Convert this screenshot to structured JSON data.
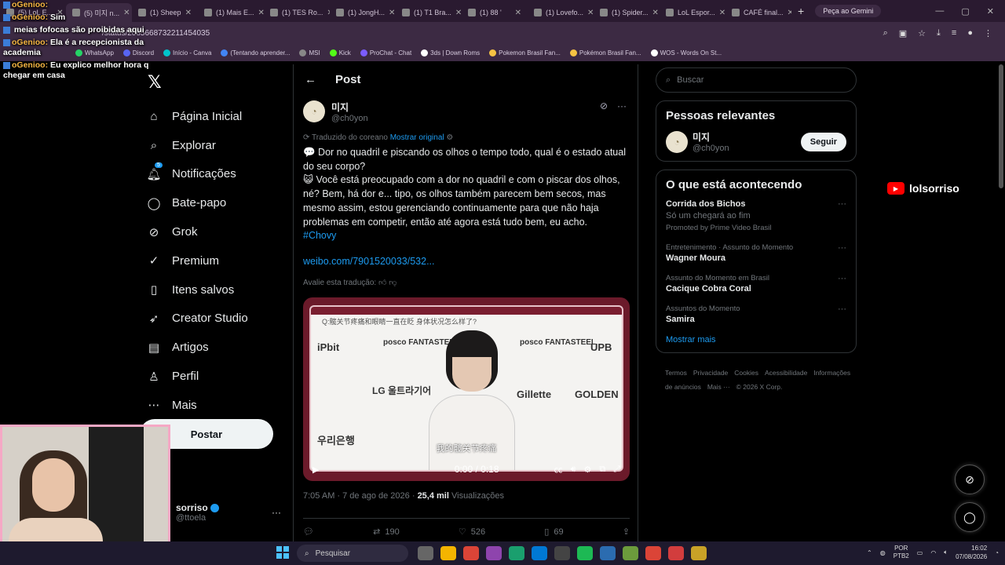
{
  "browser": {
    "tabs": [
      {
        "label": "(5) LoL E...",
        "active": false
      },
      {
        "label": "(5) 미지 n...",
        "active": true
      },
      {
        "label": "(1) Sheep",
        "active": false
      },
      {
        "label": "(1) Mais E...",
        "active": false
      },
      {
        "label": "(1) TES Ro...",
        "active": false
      },
      {
        "label": "(1) JongH...",
        "active": false
      },
      {
        "label": "(1) T1 Bra...",
        "active": false
      },
      {
        "label": "(1) 88 '",
        "active": false
      },
      {
        "label": "(1) Lovefo...",
        "active": false
      },
      {
        "label": "(1) Spider...",
        "active": false
      },
      {
        "label": "LoL Espor...",
        "active": false
      },
      {
        "label": "CAFÉ final...",
        "active": false
      }
    ],
    "new_tab": "+",
    "gemini_button": "Peça ao Gemini",
    "url": "/status/2085668732211454035",
    "bookmarks": [
      {
        "label": "Discord",
        "color": "#5865f2"
      },
      {
        "label": "Início - Canva",
        "color": "#00c4cc"
      },
      {
        "label": "(Tentando aprender...",
        "color": "#4285f4"
      },
      {
        "label": "MSI",
        "color": "#888888"
      },
      {
        "label": "Kick",
        "color": "#53fc18"
      },
      {
        "label": "ProChat - Chat",
        "color": "#7b5cff"
      },
      {
        "label": "3ds | Down Roms",
        "color": "#ffffff"
      },
      {
        "label": "Pokemon Brasil Fan...",
        "color": "#f6c343"
      },
      {
        "label": "Pokémon Brasil Fan...",
        "color": "#f6c343"
      },
      {
        "label": "WOS - Words On St...",
        "color": "#ffffff"
      }
    ],
    "whatsapp_bookmark": "WhatsApp"
  },
  "chat_overlay": [
    {
      "user": "oGenioo:",
      "text": ""
    },
    {
      "user": "oGenioo:",
      "text": "Sim"
    },
    {
      "user": "",
      "text": "meias fofocas são proibidas aqui"
    },
    {
      "user": "oGenioo:",
      "text": "Ela é a recepcionista da academia"
    },
    {
      "user": "oGenioo:",
      "text": "Eu explico melhor hora q chegar em casa"
    }
  ],
  "nav": {
    "items": [
      {
        "label": "Página Inicial",
        "icon": "home-icon"
      },
      {
        "label": "Explorar",
        "icon": "search-icon"
      },
      {
        "label": "Notificações",
        "icon": "bell-icon",
        "badge": "5"
      },
      {
        "label": "Bate-papo",
        "icon": "chat-icon"
      },
      {
        "label": "Grok",
        "icon": "grok-icon"
      },
      {
        "label": "Premium",
        "icon": "verified-icon"
      },
      {
        "label": "Itens salvos",
        "icon": "bookmark-icon"
      },
      {
        "label": "Creator Studio",
        "icon": "rocket-icon"
      },
      {
        "label": "Artigos",
        "icon": "article-icon"
      },
      {
        "label": "Perfil",
        "icon": "person-icon"
      },
      {
        "label": "Mais",
        "icon": "more-icon"
      }
    ],
    "post_button": "Postar",
    "account": {
      "name": "sorriso",
      "handle": "@ttoela"
    }
  },
  "post": {
    "header_title": "Post",
    "author_name": "미지",
    "author_handle": "@ch0yon",
    "translated_label": "Traduzido do coreano",
    "show_original": "Mostrar original",
    "body_line1": "💬 Dor no quadril e piscando os olhos o tempo todo, qual é o estado atual do seu corpo?",
    "body_line2": "😺 Você está preocupado com a dor no quadril e com o piscar dos olhos, né? Bem, há dor e... tipo, os olhos também parecem bem secos, mas mesmo assim, estou gerenciando continuamente para que não haja problemas em competir, então até agora está tudo bem, eu acho.",
    "hashtag": "#Chovy",
    "link": "weibo.com/7901520033/532...",
    "rate_translation": "Avalie esta tradução:",
    "video": {
      "time": "0:00 / 0:18",
      "caption": "我的髋关节疼痛",
      "quote": "Q:髋关节疼痛和眼睛一直在眨 身体状况怎么样了?",
      "brands": [
        "iPbit",
        "posco FANTASTEEL",
        "posco FANTASTEEL",
        "UPB",
        "LG 울트라기어",
        "Gillette",
        "GOLDEN",
        "우리은행"
      ]
    },
    "timestamp": "7:05 AM · 7 de ago de 2026",
    "views_count": "25,4 mil",
    "views_label": "Visualizações",
    "reposts": "190",
    "likes": "526",
    "bookmarks": "69"
  },
  "sidebar": {
    "search_placeholder": "Buscar",
    "relevant_title": "Pessoas relevantes",
    "relevant_name": "미지",
    "relevant_handle": "@ch0yon",
    "follow_label": "Seguir",
    "happening_title": "O que está acontecendo",
    "trends": [
      {
        "context": "",
        "title": "Corrida dos Bichos",
        "subtitle": "Só um chegará ao fim",
        "promo": "Promoted by Prime Video Brasil"
      },
      {
        "context": "Entretenimento · Assunto do Momento",
        "title": "Wagner Moura",
        "subtitle": "",
        "promo": ""
      },
      {
        "context": "Assunto do Momento em Brasil",
        "title": "Cacique Cobra Coral",
        "subtitle": "",
        "promo": ""
      },
      {
        "context": "Assuntos do Momento",
        "title": "Samira",
        "subtitle": "",
        "promo": ""
      }
    ],
    "show_more": "Mostrar mais",
    "footer": [
      "Termos",
      "Privacidade",
      "Cookies",
      "Acessibilidade",
      "Informações de anúncios",
      "Mais ···",
      "© 2026 X Corp."
    ]
  },
  "overlay_youtube": "lolsorriso",
  "taskbar": {
    "search": "Pesquisar",
    "lang_top": "POR",
    "lang_bottom": "PTB2",
    "time": "16:02",
    "date": "07/08/2026"
  },
  "colors": {
    "accent": "#1d9bf0",
    "tab_bg": "#2a1a30",
    "webcam_border": "#f5a8c5"
  }
}
